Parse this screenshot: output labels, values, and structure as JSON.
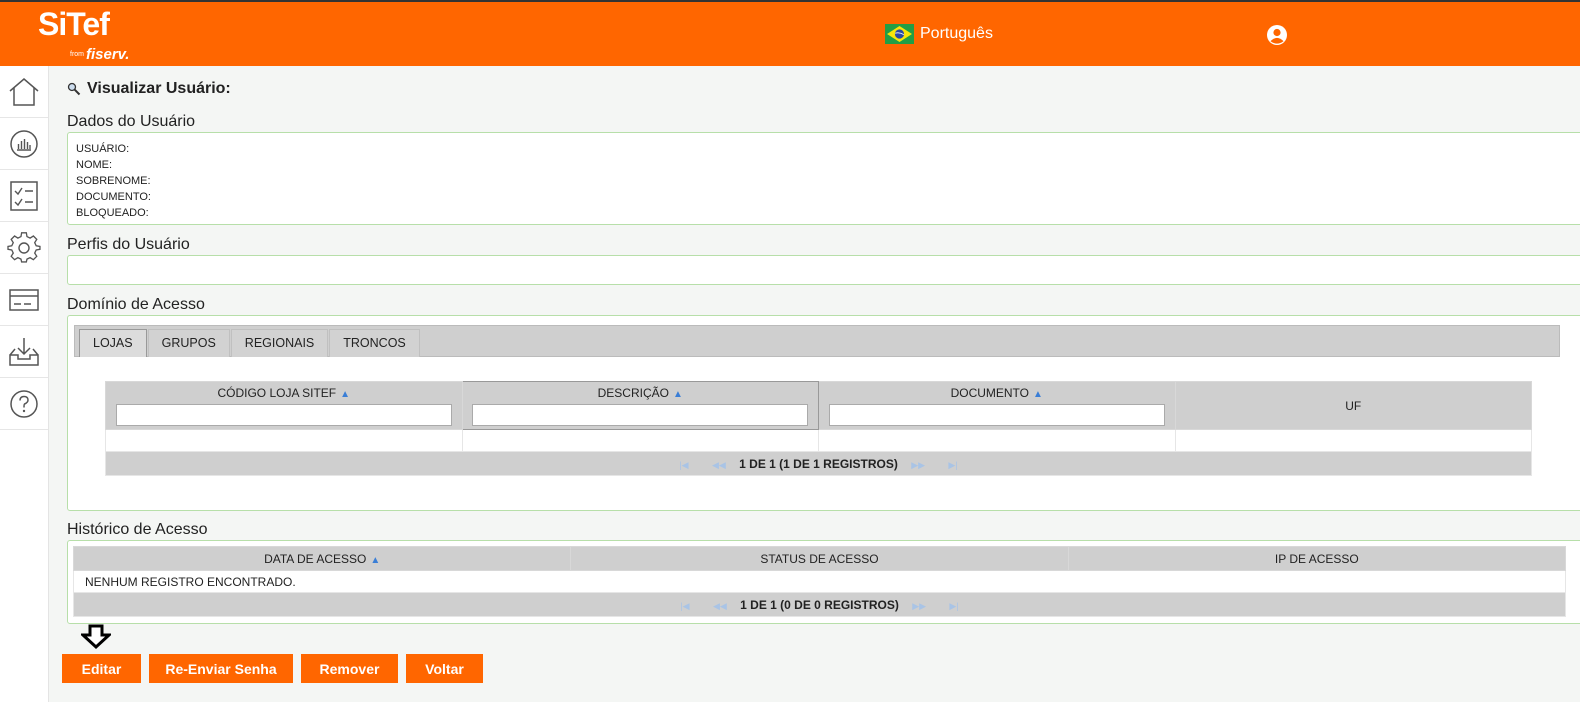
{
  "header": {
    "logo_main": "SiTef",
    "logo_from": "from",
    "logo_sub": "fiserv.",
    "language": "Português",
    "colors": {
      "brand": "#ff6600"
    }
  },
  "sidebar": {
    "items": [
      {
        "icon": "home-icon"
      },
      {
        "icon": "reports-icon"
      },
      {
        "icon": "checklist-icon"
      },
      {
        "icon": "gear-icon"
      },
      {
        "icon": "card-icon"
      },
      {
        "icon": "download-tray-icon"
      },
      {
        "icon": "help-icon"
      }
    ]
  },
  "page": {
    "title": "Visualizar Usuário:"
  },
  "user_data": {
    "title": "Dados do Usuário",
    "fields": [
      "USUÁRIO:",
      "NOME:",
      "SOBRENOME:",
      "DOCUMENTO:",
      "BLOQUEADO:"
    ]
  },
  "profiles": {
    "title": "Perfis do Usuário"
  },
  "access_domain": {
    "title": "Domínio de Acesso",
    "tabs": [
      "LOJAS",
      "GRUPOS",
      "REGIONAIS",
      "TRONCOS"
    ],
    "columns": [
      "CÓDIGO LOJA SITEF",
      "DESCRIÇÃO",
      "DOCUMENTO",
      "UF"
    ],
    "pager": "1 DE 1 (1 DE 1 REGISTROS)"
  },
  "access_history": {
    "title": "Histórico de Acesso",
    "columns": [
      "DATA DE ACESSO",
      "STATUS DE ACESSO",
      "IP DE ACESSO"
    ],
    "empty_message": "NENHUM REGISTRO ENCONTRADO.",
    "pager": "1 DE 1 (0 DE 0 REGISTROS)"
  },
  "buttons": {
    "edit": "Editar",
    "resend_password": "Re-Enviar Senha",
    "remove": "Remover",
    "back": "Voltar"
  }
}
